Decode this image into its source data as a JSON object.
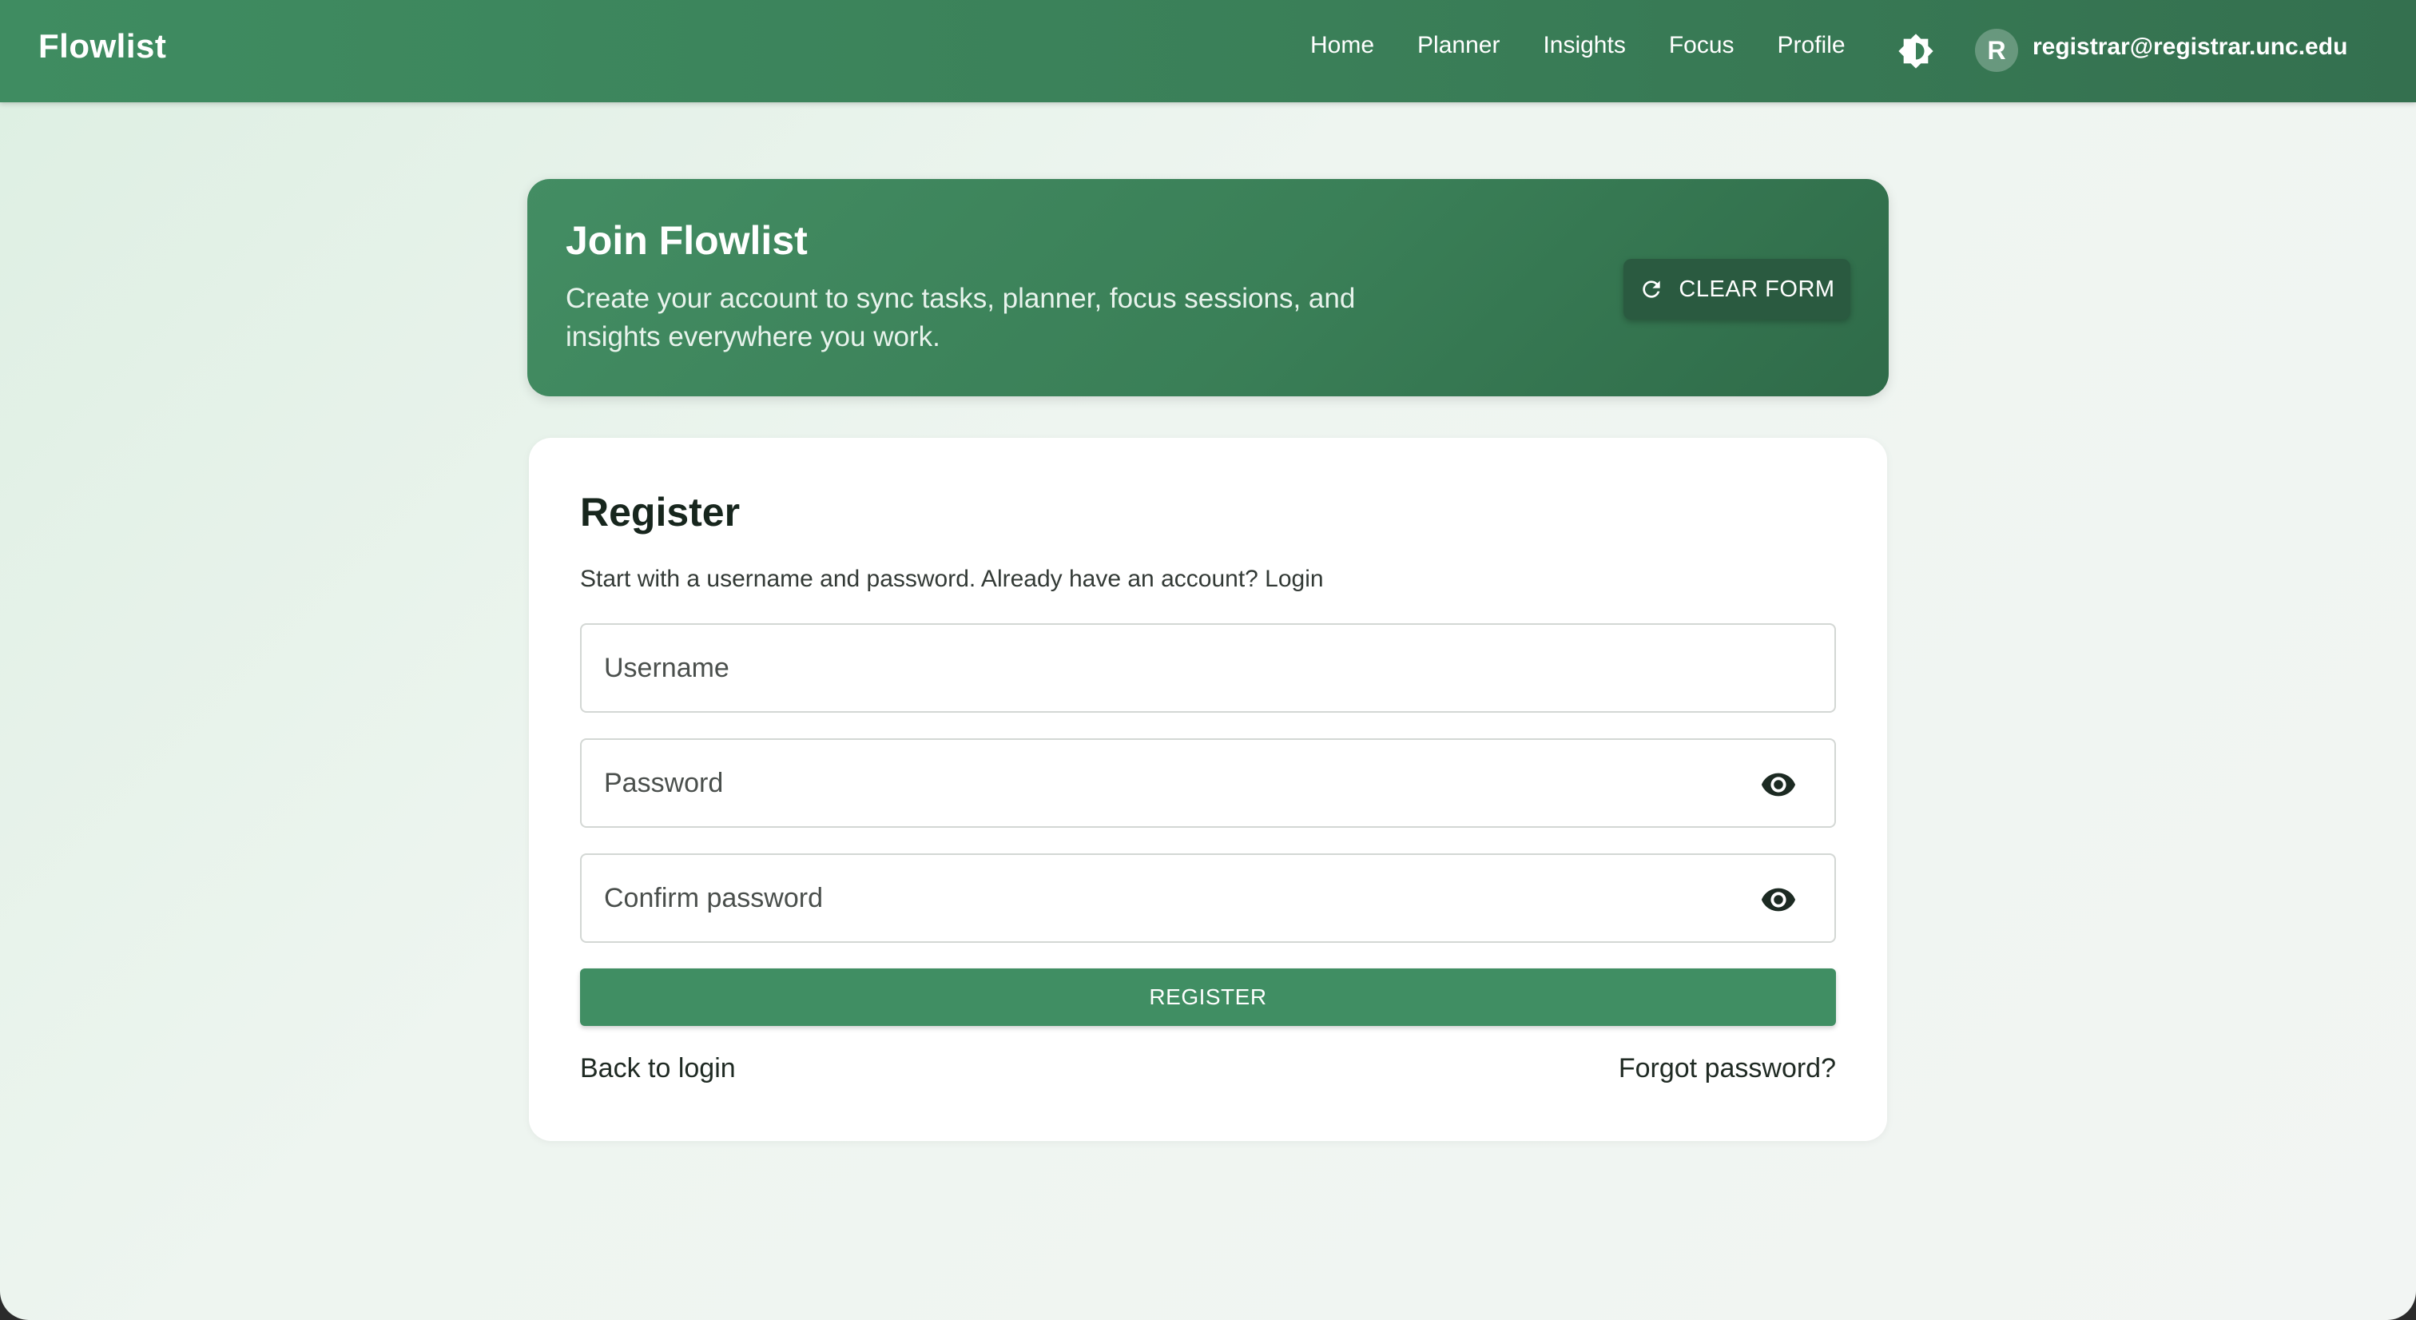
{
  "header": {
    "brand": "Flowlist",
    "nav": [
      {
        "label": "Home"
      },
      {
        "label": "Planner"
      },
      {
        "label": "Insights"
      },
      {
        "label": "Focus"
      },
      {
        "label": "Profile"
      }
    ],
    "theme_icon": "brightness-icon",
    "avatar_initial": "R",
    "user_email": "registrar@registrar.unc.edu"
  },
  "hero": {
    "title": "Join Flowlist",
    "subtitle": "Create your account to sync tasks, planner, focus sessions, and insights everywhere you work.",
    "clear_button": "CLEAR FORM",
    "clear_icon": "refresh-icon"
  },
  "form": {
    "title": "Register",
    "subtitle": "Start with a username and password. Already have an account? Login",
    "username_placeholder": "Username",
    "password_placeholder": "Password",
    "confirm_placeholder": "Confirm password",
    "eye_icon": "eye-icon",
    "register_button": "REGISTER",
    "back_link": "Back to login",
    "forgot_link": "Forgot password?"
  },
  "colors": {
    "primary_green": "#408e63",
    "dark_green": "#2a5a40",
    "text_dark": "#17261d"
  }
}
